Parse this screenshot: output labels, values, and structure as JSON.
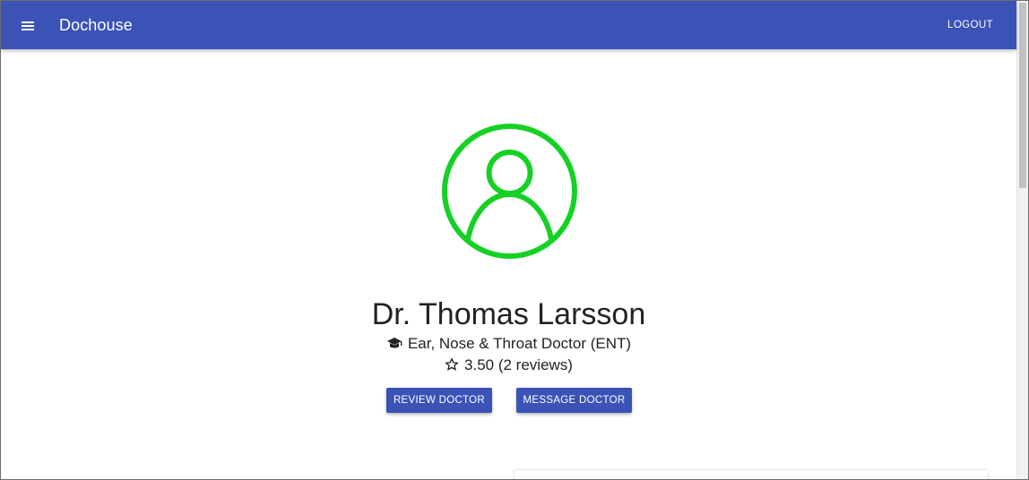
{
  "appbar": {
    "title": "Dochouse",
    "logout_label": "LOGOUT"
  },
  "profile": {
    "name": "Dr. Thomas Larsson",
    "specialty": "Ear, Nose & Throat Doctor (ENT)",
    "rating_text": "3.50 (2 reviews)",
    "rating_value": 3.5,
    "review_count": 2,
    "avatar_color": "#16d125"
  },
  "actions": {
    "review_label": "REVIEW DOCTOR",
    "message_label": "MESSAGE DOCTOR"
  },
  "colors": {
    "primary": "#3b52b6",
    "text": "#222222"
  }
}
